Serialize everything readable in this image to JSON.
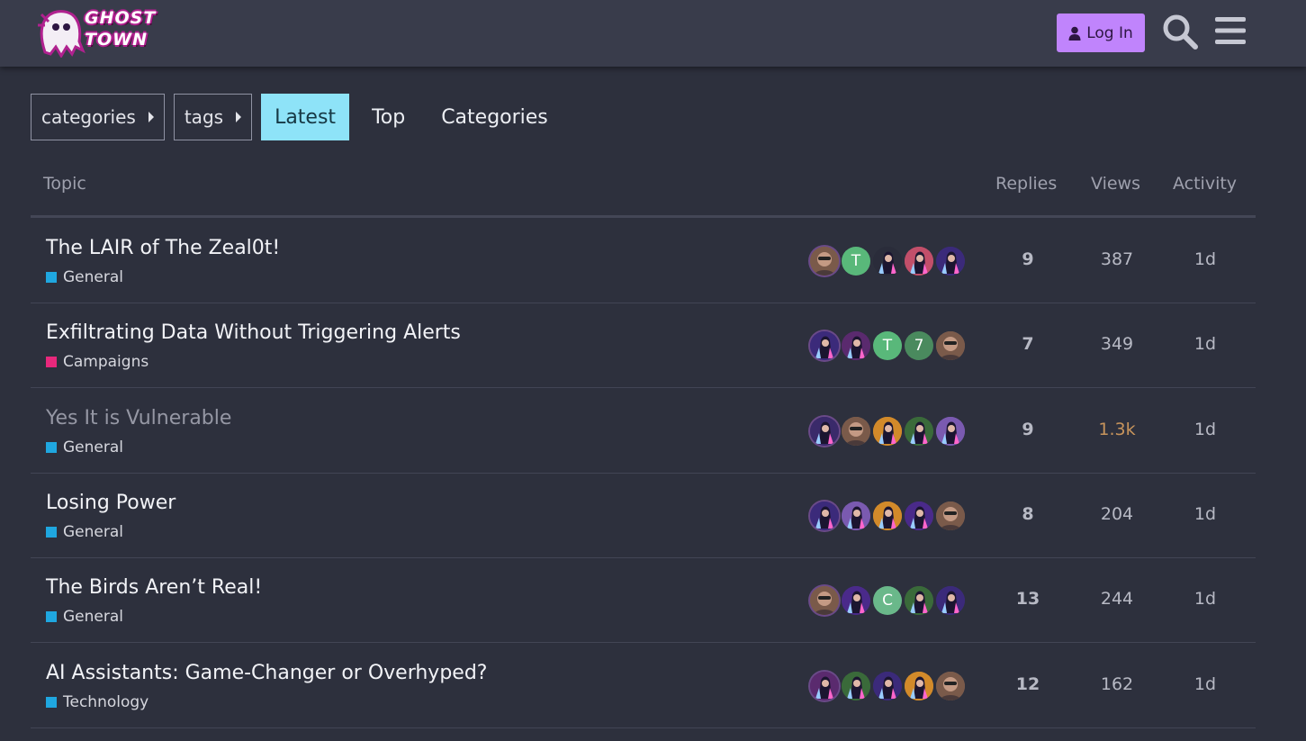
{
  "header": {
    "logo_text": "GHOST\nTOWN",
    "login_label": "Log In",
    "login_icon": "user-icon",
    "search_icon": "search-icon",
    "menu_icon": "hamburger-menu-icon",
    "accent_color": "#c084fc"
  },
  "nav": {
    "dropdowns": [
      {
        "label": "categories"
      },
      {
        "label": "tags"
      }
    ],
    "tabs": [
      {
        "label": "Latest",
        "active": true
      },
      {
        "label": "Top",
        "active": false
      },
      {
        "label": "Categories",
        "active": false
      }
    ]
  },
  "table": {
    "headers": {
      "topic": "Topic",
      "replies": "Replies",
      "views": "Views",
      "activity": "Activity"
    },
    "rows": [
      {
        "title": "The LAIR of The Zeal0t!",
        "category": "General",
        "category_color": "#1fa7e0",
        "replies": "9",
        "views": "387",
        "activity": "1d",
        "visited": false,
        "hot": false,
        "posters": [
          {
            "letter": "",
            "color": "#8a6a5a",
            "kind": "photo"
          },
          {
            "letter": "T",
            "color": "#59b87a",
            "kind": "letter"
          },
          {
            "letter": "",
            "color": "#2a2c3a",
            "kind": "art"
          },
          {
            "letter": "",
            "color": "#c24f6a",
            "kind": "art"
          },
          {
            "letter": "",
            "color": "#3b2a7a",
            "kind": "art"
          }
        ]
      },
      {
        "title": "Exfiltrating Data Without Triggering Alerts",
        "category": "Campaigns",
        "category_color": "#e8287c",
        "replies": "7",
        "views": "349",
        "activity": "1d",
        "visited": false,
        "hot": false,
        "posters": [
          {
            "letter": "",
            "color": "#3b2a7a",
            "kind": "art"
          },
          {
            "letter": "",
            "color": "#5a2a6e",
            "kind": "art"
          },
          {
            "letter": "T",
            "color": "#59b87a",
            "kind": "letter"
          },
          {
            "letter": "7",
            "color": "#4a8a5e",
            "kind": "letter"
          },
          {
            "letter": "",
            "color": "#8a6a5a",
            "kind": "photo"
          }
        ]
      },
      {
        "title": "Yes It is Vulnerable",
        "category": "General",
        "category_color": "#1fa7e0",
        "replies": "9",
        "views": "1.3k",
        "activity": "1d",
        "visited": true,
        "hot": true,
        "posters": [
          {
            "letter": "",
            "color": "#3a2a6a",
            "kind": "art"
          },
          {
            "letter": "",
            "color": "#8a6a5a",
            "kind": "photo"
          },
          {
            "letter": "",
            "color": "#d28a2a",
            "kind": "art"
          },
          {
            "letter": "",
            "color": "#3a6a3a",
            "kind": "art"
          },
          {
            "letter": "",
            "color": "#7a5ab0",
            "kind": "art"
          }
        ]
      },
      {
        "title": "Losing Power",
        "category": "General",
        "category_color": "#1fa7e0",
        "replies": "8",
        "views": "204",
        "activity": "1d",
        "visited": false,
        "hot": false,
        "posters": [
          {
            "letter": "",
            "color": "#3b2a7a",
            "kind": "art"
          },
          {
            "letter": "",
            "color": "#7a5ab0",
            "kind": "art"
          },
          {
            "letter": "",
            "color": "#d28a2a",
            "kind": "art"
          },
          {
            "letter": "",
            "color": "#4a2a8a",
            "kind": "art"
          },
          {
            "letter": "",
            "color": "#8a6a5a",
            "kind": "photo"
          }
        ]
      },
      {
        "title": "The Birds Aren’t Real!",
        "category": "General",
        "category_color": "#1fa7e0",
        "replies": "13",
        "views": "244",
        "activity": "1d",
        "visited": false,
        "hot": false,
        "posters": [
          {
            "letter": "",
            "color": "#8a6a5a",
            "kind": "photo"
          },
          {
            "letter": "",
            "color": "#4a2a8a",
            "kind": "art"
          },
          {
            "letter": "C",
            "color": "#6ab88a",
            "kind": "letter"
          },
          {
            "letter": "",
            "color": "#3a6a3a",
            "kind": "art"
          },
          {
            "letter": "",
            "color": "#3b2a7a",
            "kind": "art"
          }
        ]
      },
      {
        "title": "AI Assistants: Game-Changer or Overhyped?",
        "category": "Technology",
        "category_color": "#1fa7e0",
        "replies": "12",
        "views": "162",
        "activity": "1d",
        "visited": false,
        "hot": false,
        "posters": [
          {
            "letter": "",
            "color": "#5a2a6e",
            "kind": "art"
          },
          {
            "letter": "",
            "color": "#3a6a3a",
            "kind": "art"
          },
          {
            "letter": "",
            "color": "#3b2a7a",
            "kind": "art"
          },
          {
            "letter": "",
            "color": "#d28a2a",
            "kind": "art"
          },
          {
            "letter": "",
            "color": "#8a6a5a",
            "kind": "photo"
          }
        ]
      }
    ]
  }
}
